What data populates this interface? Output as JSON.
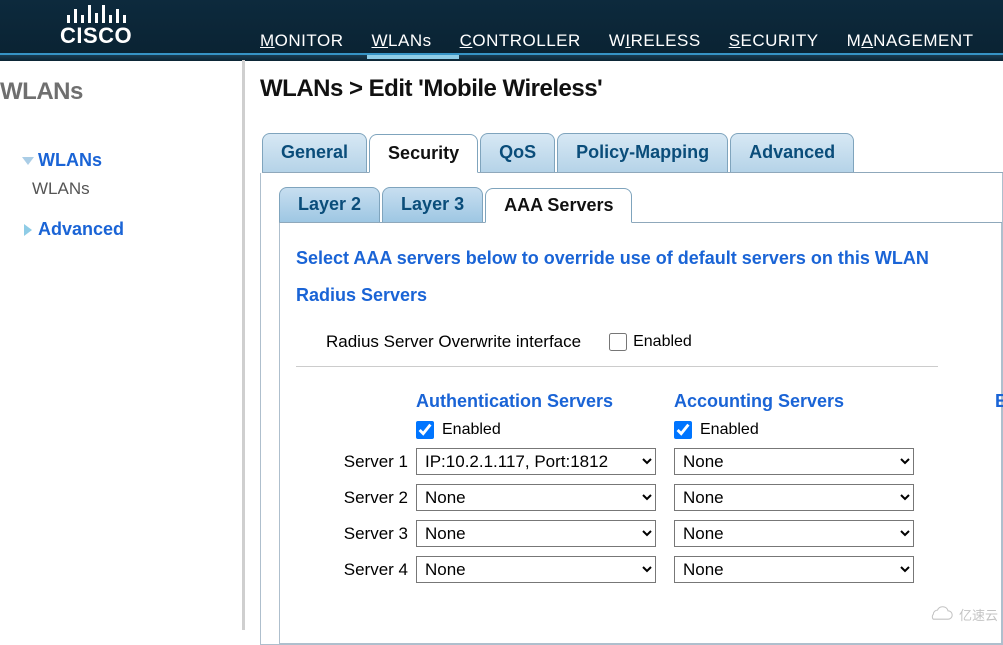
{
  "brand": "CISCO",
  "topnav": [
    "MONITOR",
    "WLANs",
    "CONTROLLER",
    "WIRELESS",
    "SECURITY",
    "MANAGEMENT"
  ],
  "topnav_active": 1,
  "sidebar": {
    "title": "WLANs",
    "items": [
      {
        "label": "WLANs",
        "children": [
          {
            "label": "WLANs"
          }
        ]
      },
      {
        "label": "Advanced"
      }
    ]
  },
  "page_title": "WLANs > Edit   'Mobile Wireless'",
  "main_tabs": [
    "General",
    "Security",
    "QoS",
    "Policy-Mapping",
    "Advanced"
  ],
  "main_tabs_active": 1,
  "sub_tabs": [
    "Layer 2",
    "Layer 3",
    "AAA Servers"
  ],
  "sub_tabs_active": 2,
  "aaa": {
    "intro": "Select AAA servers below to override use of default servers on this WLAN",
    "radius_title": "Radius Servers",
    "overwrite_label": "Radius Server Overwrite interface",
    "overwrite_enabled_label": "Enabled",
    "overwrite_checked": false,
    "cols": {
      "auth": "Authentication Servers",
      "acct": "Accounting Servers",
      "eap": "EAP"
    },
    "auth_enabled": true,
    "acct_enabled": true,
    "enabled_label": "Enabled",
    "eap_row2": "E",
    "rows": [
      {
        "label": "Server 1",
        "auth": "IP:10.2.1.117, Port:1812",
        "acct": "None"
      },
      {
        "label": "Server 2",
        "auth": "None",
        "acct": "None"
      },
      {
        "label": "Server 3",
        "auth": "None",
        "acct": "None"
      },
      {
        "label": "Server 4",
        "auth": "None",
        "acct": "None"
      }
    ]
  },
  "watermark": "亿速云"
}
